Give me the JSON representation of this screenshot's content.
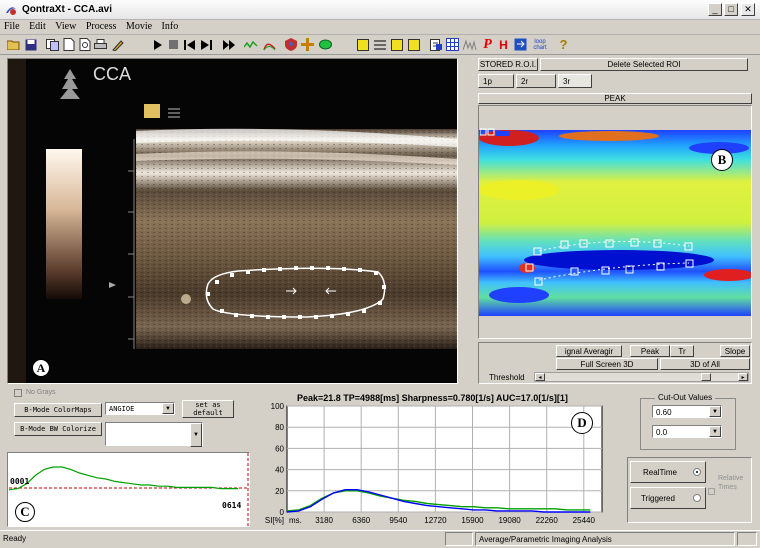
{
  "window": {
    "title": "QontraXt - CCA.avi",
    "minimize": "_",
    "maximize": "□",
    "close": "✕"
  },
  "menu": [
    "File",
    "Edit",
    "View",
    "Process",
    "Movie",
    "Info"
  ],
  "toolbar_icons": [
    "open-folder",
    "save",
    "copy-pages",
    "page",
    "preview",
    "print",
    "brush",
    "play",
    "stop",
    "step-back",
    "step-forward",
    "fast-forward",
    "wave",
    "curve",
    "shield",
    "cross",
    "ellipse",
    "yellow-square",
    "stripes",
    "yellow-square-2",
    "yellow-square-3",
    "clipboard",
    "grid",
    "spectrum",
    "p-letter",
    "h-letter",
    "sync",
    "loop-chart",
    "question"
  ],
  "toolbar_text": {
    "p": "P",
    "h": "H",
    "loop": "loop chart",
    "q": "?"
  },
  "ultrasound": {
    "label": "CCA",
    "panel_marker": "A"
  },
  "roi": {
    "stored_label": "STORED R.O.I.",
    "delete_label": "Delete Selected ROI",
    "tabs": [
      "1p",
      "2r",
      "3r"
    ],
    "peak_label": "PEAK",
    "panel_marker": "B"
  },
  "param_controls": {
    "signal_avg": "ignal Averagir",
    "peak": "Peak",
    "tr": "Tr",
    "slope": "Slope",
    "full_screen": "Full Screen 3D",
    "all_3d": "3D of All",
    "threshold": "Threshold"
  },
  "bmode": {
    "no_grays": "No Grays",
    "colormaps_label": "B-Mode ColorMaps",
    "colormap_value": "ANGIOE",
    "set_default": "set as default",
    "bw_colorize": "B-Mode BW Colorize",
    "bw_value": ""
  },
  "mini_chart": {
    "left_label": "0001",
    "right_label": "0614",
    "panel_marker": "C"
  },
  "chart_data": {
    "type": "line",
    "title": "Peak=21.8  TP=4988[ms]  Sharpness=0.780[1/s]  AUC=17.0[1/s][1]",
    "xlabel": "ms.",
    "ylabel": "SI[%]",
    "x_ticks": [
      3180,
      6360,
      9540,
      12720,
      15900,
      19080,
      22260,
      25440
    ],
    "y_ticks": [
      0,
      20,
      40,
      60,
      80,
      100
    ],
    "xlim": [
      0,
      27000
    ],
    "ylim": [
      0,
      100
    ],
    "grid": true,
    "panel_marker": "D",
    "series": [
      {
        "color": "#00a000",
        "x": [
          0,
          1000,
          2000,
          3000,
          4000,
          5000,
          6000,
          7000,
          8000,
          9000,
          10000,
          11000,
          12000,
          13000,
          14000,
          15000,
          16000,
          17000,
          18000,
          19000,
          20000,
          21000,
          22000,
          23000,
          24000,
          25000,
          26000
        ],
        "values": [
          1,
          2,
          6,
          13,
          18,
          20,
          20,
          18,
          15,
          13,
          11,
          10,
          8,
          7,
          6,
          5,
          5,
          4,
          4,
          3,
          3,
          3,
          3,
          3,
          2,
          2,
          2
        ]
      },
      {
        "color": "#0000ff",
        "x": [
          0,
          1000,
          2000,
          3000,
          4000,
          5000,
          6000,
          7000,
          8000,
          9000,
          10000,
          11000,
          12000,
          13000,
          14000,
          15000,
          16000,
          17000,
          18000,
          19000,
          20000,
          21000,
          22000,
          23000,
          24000,
          25000,
          26000
        ],
        "values": [
          0,
          1,
          5,
          12,
          18,
          21,
          21,
          19,
          16,
          13,
          10,
          8,
          6,
          5,
          4,
          3,
          2,
          2,
          1,
          1,
          1,
          1,
          0,
          0,
          0,
          0,
          0
        ]
      }
    ]
  },
  "cutout": {
    "title": "Cut-Out Values",
    "value1": "0.60",
    "value2": "0.0"
  },
  "mode": {
    "realtime": "RealTime",
    "triggered": "Triggered",
    "relative": "Relative Times"
  },
  "status": {
    "ready": "Ready",
    "right": "Average/Parametric Imaging Analysis"
  },
  "colors": {
    "chrome": "#d4d0c8",
    "chart_green": "#00a000",
    "chart_blue": "#0000ff"
  }
}
